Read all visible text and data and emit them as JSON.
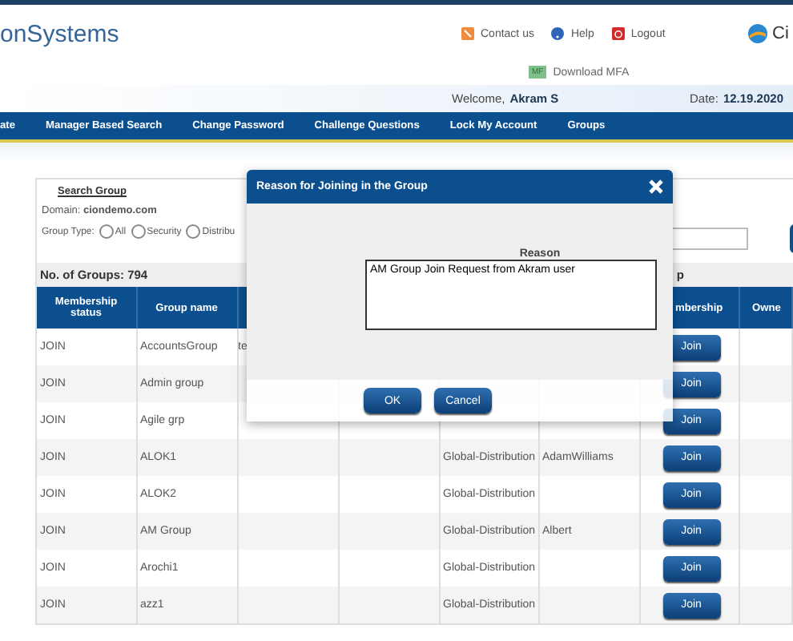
{
  "header": {
    "logo_text": "onSystems",
    "brand_text": "Ci",
    "links": [
      {
        "kind": "contact",
        "label": "Contact us"
      },
      {
        "kind": "help",
        "label": "Help"
      },
      {
        "kind": "logout",
        "label": "Logout"
      }
    ],
    "download": {
      "badge": "MF",
      "label": "Download MFA"
    }
  },
  "welcome": {
    "greeting": "Welcome,",
    "user": "Akram S",
    "date_label": "Date:",
    "date": "12.19.2020"
  },
  "nav": [
    "ate",
    "Manager Based Search",
    "Change Password",
    "Challenge Questions",
    "Lock My Account",
    "Groups"
  ],
  "search": {
    "title": "Search Group",
    "domain_label": "Domain:",
    "domain": "ciondemo.com",
    "group_type_label": "Group Type:",
    "group_types": [
      {
        "label": "All",
        "selected": false
      },
      {
        "label": "Security",
        "selected": false
      },
      {
        "label": "Distribu",
        "selected": false
      }
    ],
    "count_label": "No. of Groups: 794",
    "count_fragment": "p"
  },
  "table": {
    "columns": [
      "Membership status",
      "Group name",
      "",
      "",
      "",
      "",
      "mbership",
      "Owne"
    ],
    "rows": [
      {
        "cells": [
          "JOIN",
          "AccountsGroup",
          "te",
          "",
          "",
          "",
          ""
        ],
        "button": "Join"
      },
      {
        "cells": [
          "JOIN",
          "Admin group",
          "",
          "",
          "",
          "",
          ""
        ],
        "button": "Join"
      },
      {
        "cells": [
          "JOIN",
          "Agile grp",
          "",
          "",
          "",
          "",
          ""
        ],
        "button": "Join"
      },
      {
        "cells": [
          "JOIN",
          "ALOK1",
          "",
          "",
          "Global-Distribution",
          "AdamWilliams",
          ""
        ],
        "button": "Join"
      },
      {
        "cells": [
          "JOIN",
          "ALOK2",
          "",
          "",
          "Global-Distribution",
          "",
          ""
        ],
        "button": "Join"
      },
      {
        "cells": [
          "JOIN",
          "AM Group",
          "",
          "",
          "Global-Distribution",
          "Albert",
          ""
        ],
        "button": "Join"
      },
      {
        "cells": [
          "JOIN",
          "Arochi1",
          "",
          "",
          "Global-Distribution",
          "",
          ""
        ],
        "button": "Join"
      },
      {
        "cells": [
          "JOIN",
          "azz1",
          "",
          "",
          "Global-Distribution",
          "",
          ""
        ],
        "button": "Join"
      }
    ]
  },
  "dialog": {
    "title": "Reason for Joining in the Group",
    "field_label": "Reason",
    "value": "AM Group Join Request from Akram user",
    "buttons": [
      "OK",
      "Cancel"
    ]
  }
}
